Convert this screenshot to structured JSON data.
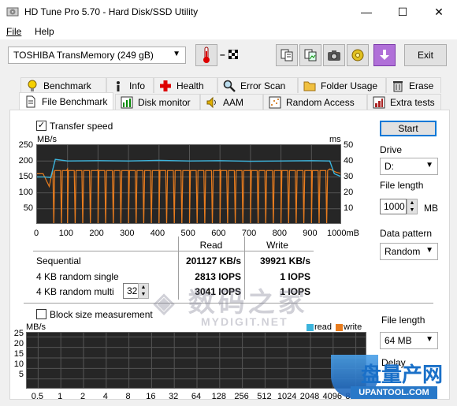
{
  "window": {
    "title": "HD Tune Pro 5.70 - Hard Disk/SSD Utility",
    "minimize": "—",
    "maximize": "☐",
    "close": "✕"
  },
  "menu": {
    "file": "File",
    "help": "Help"
  },
  "toolbar": {
    "drive": "TOSHIBA TransMemory (249 gB)",
    "temperature": "– ",
    "exit": "Exit"
  },
  "tabs_row1": [
    "Benchmark",
    "Info",
    "Health",
    "Error Scan",
    "Folder Usage",
    "Erase"
  ],
  "tabs_row2": [
    "File Benchmark",
    "Disk monitor",
    "AAM",
    "Random Access",
    "Extra tests"
  ],
  "file_benchmark": {
    "transfer_speed_label": "Transfer speed",
    "transfer_speed_checked": true,
    "unit_left": "MB/s",
    "unit_right": "ms",
    "y_left_ticks": [
      "250",
      "200",
      "150",
      "100",
      "50"
    ],
    "y_right_ticks": [
      "50",
      "40",
      "30",
      "20",
      "10"
    ],
    "x_ticks": [
      "0",
      "100",
      "200",
      "300",
      "400",
      "500",
      "600",
      "700",
      "800",
      "900",
      "1000mB"
    ],
    "results": {
      "col_read": "Read",
      "col_write": "Write",
      "rows": [
        {
          "label": "Sequential",
          "read": "201127 KB/s",
          "write": "39921 KB/s"
        },
        {
          "label": "4 KB random single",
          "read": "2813 IOPS",
          "write": "1 IOPS"
        },
        {
          "label": "4 KB random multi",
          "read": "3041 IOPS",
          "write": "1 IOPS"
        }
      ],
      "multi_queue": "32"
    },
    "block_size_label": "Block size measurement",
    "block_size_checked": false,
    "block_unit": "MB/s",
    "block_y_ticks": [
      "25",
      "20",
      "15",
      "10",
      "5"
    ],
    "block_x_ticks": [
      "0.5",
      "1",
      "2",
      "4",
      "8",
      "16",
      "32",
      "64",
      "128",
      "256",
      "512",
      "1024",
      "2048",
      "4096",
      "8192"
    ],
    "legend_read": "read",
    "legend_write": "write",
    "colors": {
      "read": "#3cb4dc",
      "write": "#e87c1e",
      "background": "#262626"
    }
  },
  "side_controls": {
    "start": "Start",
    "drive_label": "Drive",
    "drive_value": "D:",
    "file_length_label": "File length",
    "file_length_value": "1000",
    "file_length_unit": "MB",
    "data_pattern_label": "Data pattern",
    "data_pattern_value": "Random",
    "file_length2_label": "File length",
    "file_length2_value": "64 MB",
    "delay_label": "Delay"
  },
  "chart_data": {
    "type": "line",
    "xlabel": "",
    "xlim": [
      0,
      1000
    ],
    "ylim": [
      0,
      250
    ],
    "ylabel": "MB/s",
    "y2lim": [
      0,
      50
    ],
    "series": [
      {
        "name": "read",
        "color": "#3cb4dc",
        "x": [
          0,
          25,
          45,
          60,
          100,
          200,
          300,
          400,
          500,
          600,
          700,
          800,
          900,
          960,
          975,
          1000
        ],
        "values": [
          150,
          150,
          148,
          205,
          200,
          201,
          200,
          202,
          200,
          201,
          199,
          200,
          201,
          200,
          160,
          150
        ]
      },
      {
        "name": "write",
        "color": "#e87c1e",
        "x": [
          0,
          20,
          40,
          50,
          60,
          100,
          200,
          300,
          400,
          500,
          600,
          700,
          800,
          900,
          960,
          980,
          1000
        ],
        "values": [
          160,
          160,
          120,
          165,
          170,
          175,
          172,
          170,
          171,
          170,
          172,
          171,
          170,
          170,
          175,
          165,
          160
        ]
      }
    ],
    "write_dips_x": [
      55,
      80,
      100,
      125,
      150,
      175,
      200,
      225,
      250,
      275,
      300,
      325,
      350,
      375,
      400,
      425,
      450,
      475,
      500,
      525,
      550,
      575,
      600,
      625,
      650,
      675,
      700,
      725,
      750,
      775,
      800,
      825,
      850,
      875,
      900,
      925,
      950
    ],
    "write_dip_value": 0
  }
}
